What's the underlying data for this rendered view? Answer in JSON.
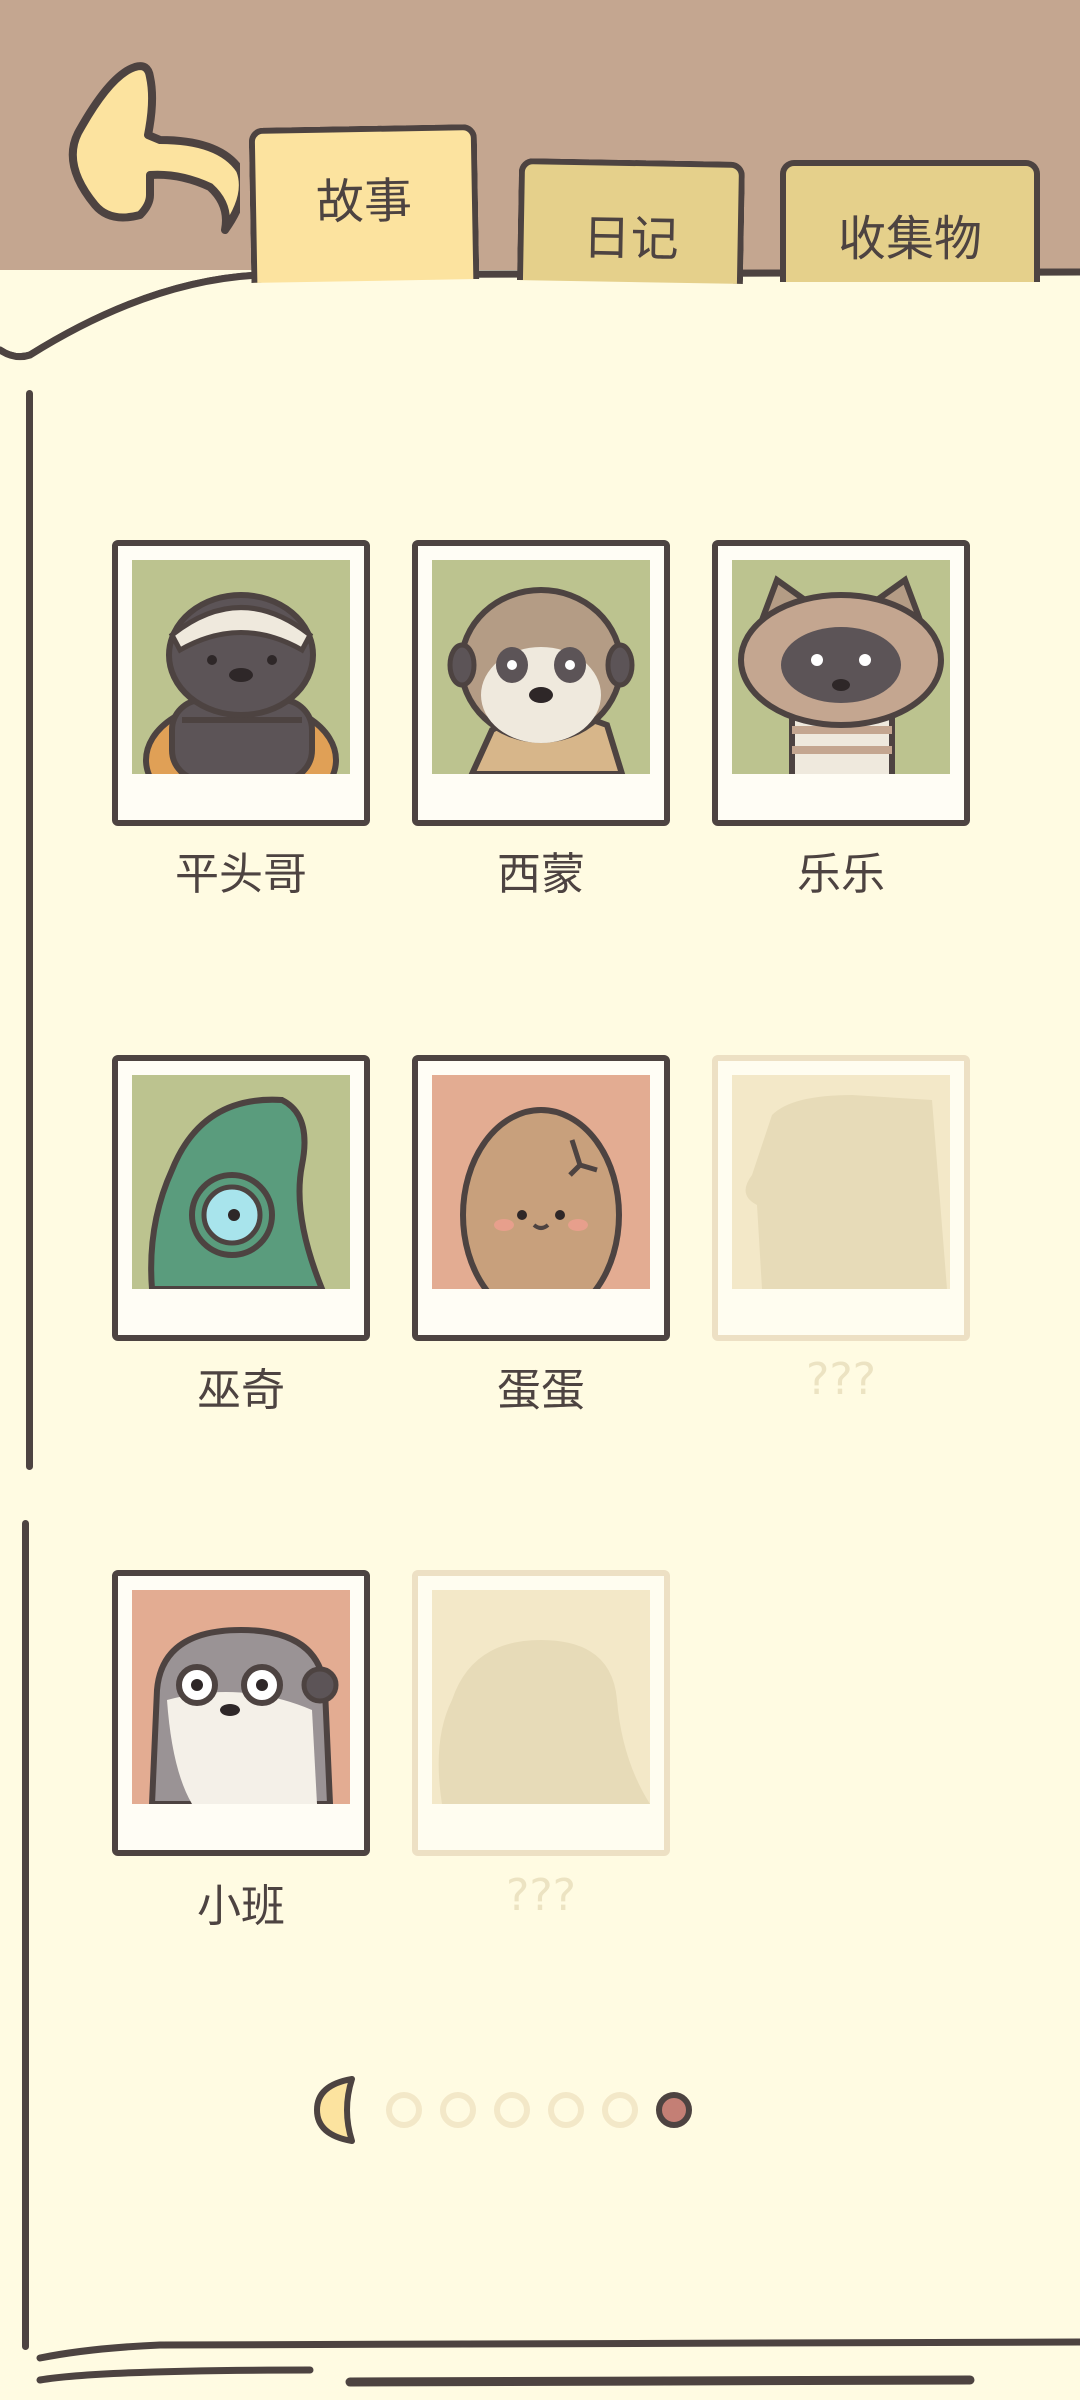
{
  "tabs": [
    {
      "label": "故事",
      "active": true
    },
    {
      "label": "日记",
      "active": false
    },
    {
      "label": "收集物",
      "active": false
    }
  ],
  "characters": [
    {
      "name": "平头哥",
      "locked": false,
      "bg": "#bcc38f",
      "icon": "honey-badger-icon"
    },
    {
      "name": "西蒙",
      "locked": false,
      "bg": "#bcc38f",
      "icon": "meerkat-icon"
    },
    {
      "name": "乐乐",
      "locked": false,
      "bg": "#bcc38f",
      "icon": "raccoon-icon"
    },
    {
      "name": "巫奇",
      "locked": false,
      "bg": "#bcc38f",
      "icon": "chameleon-icon"
    },
    {
      "name": "蛋蛋",
      "locked": false,
      "bg": "#e3ac92",
      "icon": "egg-icon"
    },
    {
      "name": "???",
      "locked": true,
      "bg": "#f3e8c8",
      "icon": "silhouette-icon"
    },
    {
      "name": "小班",
      "locked": false,
      "bg": "#e3ac92",
      "icon": "otter-icon"
    },
    {
      "name": "???",
      "locked": true,
      "bg": "#f3e8c8",
      "icon": "silhouette-icon"
    }
  ],
  "pagination": {
    "total": 6,
    "current": 6
  },
  "colors": {
    "outline": "#4d4341",
    "page": "#fffbe2",
    "header": "#c4a690",
    "tab_active": "#fce39f",
    "tab_inactive": "#e5d08b"
  }
}
